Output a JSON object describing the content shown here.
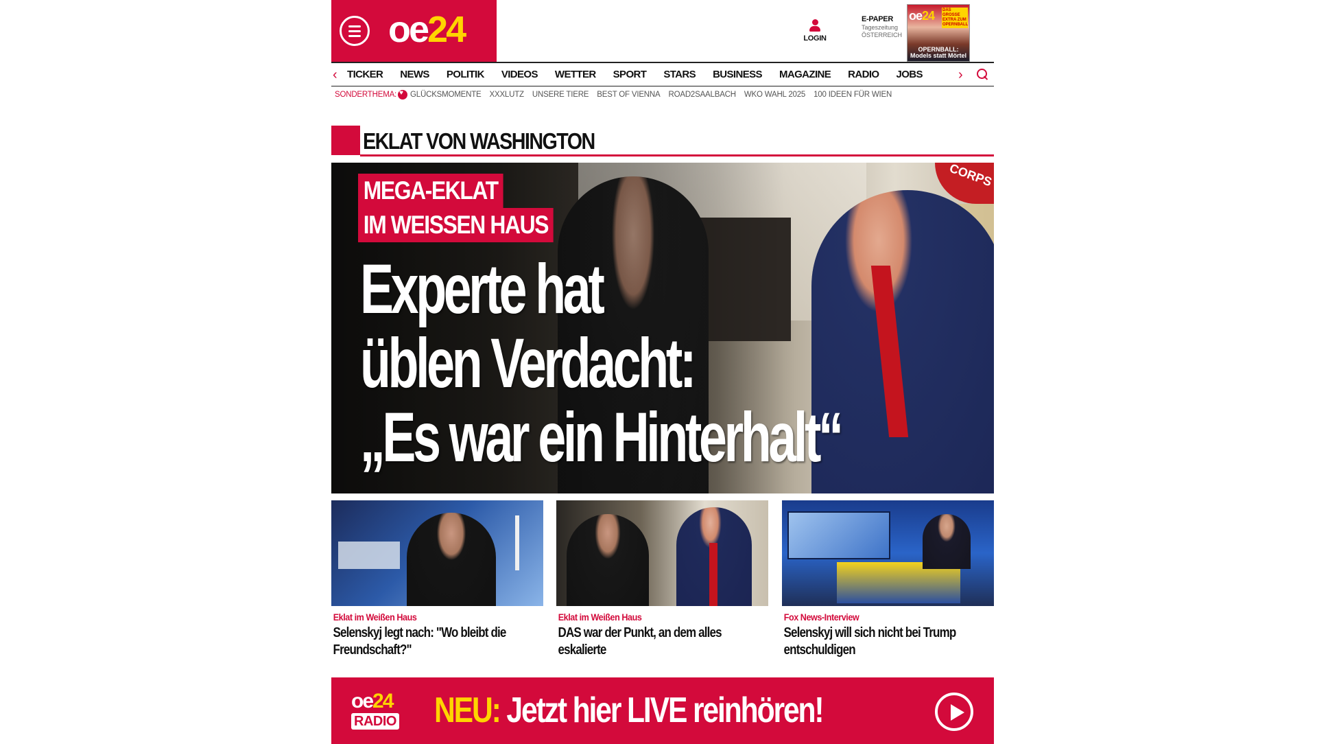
{
  "header": {
    "logo_oe": "oe",
    "logo_num": "24",
    "login_label": "LOGIN",
    "epaper_title": "E-PAPER",
    "epaper_sub1": "Tageszeitung",
    "epaper_sub2": "ÖSTERREICH",
    "cover_logo_oe": "oe",
    "cover_logo_num": "24",
    "cover_badge": "DAS GROSSE EXTRA ZUM OPERNBALL",
    "cover_headline": "OPERNBALL: Models statt Mörtel"
  },
  "nav": {
    "items": [
      "TICKER",
      "NEWS",
      "POLITIK",
      "VIDEOS",
      "WETTER",
      "SPORT",
      "STARS",
      "BUSINESS",
      "MAGAZINE",
      "RADIO",
      "JOBS"
    ]
  },
  "sonderthema": {
    "label": "SONDERTHEMA:",
    "items": [
      "GLÜCKSMOMENTE",
      "XXXLUTZ",
      "UNSERE TIERE",
      "BEST OF VIENNA",
      "ROAD2SAALBACH",
      "WKO WAHL 2025",
      "100 IDEEN FÜR WIEN"
    ]
  },
  "section": {
    "title": "EKLAT VON WASHINGTON"
  },
  "hero": {
    "kicker_line1": "MEGA-EKLAT",
    "kicker_line2": "IM WEISSEN HAUS",
    "headline_line1": "Experte hat",
    "headline_line2": "üblen Verdacht:",
    "headline_line3": "„Es war ein Hinterhalt“",
    "flag_text": "CORPS"
  },
  "teasers": [
    {
      "category": "Eklat im Weißen Haus",
      "title": "Selenskyj legt nach: \"Wo bleibt die Freundschaft?\""
    },
    {
      "category": "Eklat im Weißen Haus",
      "title": "DAS war der Punkt, an dem alles eskalierte"
    },
    {
      "category": "Fox News-Interview",
      "title": "Selenskyj will sich nicht bei Trump entschuldigen"
    }
  ],
  "radio": {
    "logo_oe": "oe",
    "logo_num": "24",
    "logo_box": "RADIO",
    "neu": "NEU:",
    "text": " Jetzt hier LIVE reinhören!"
  },
  "colors": {
    "brand_red": "#d30a3b",
    "brand_yellow": "#ffd400"
  }
}
